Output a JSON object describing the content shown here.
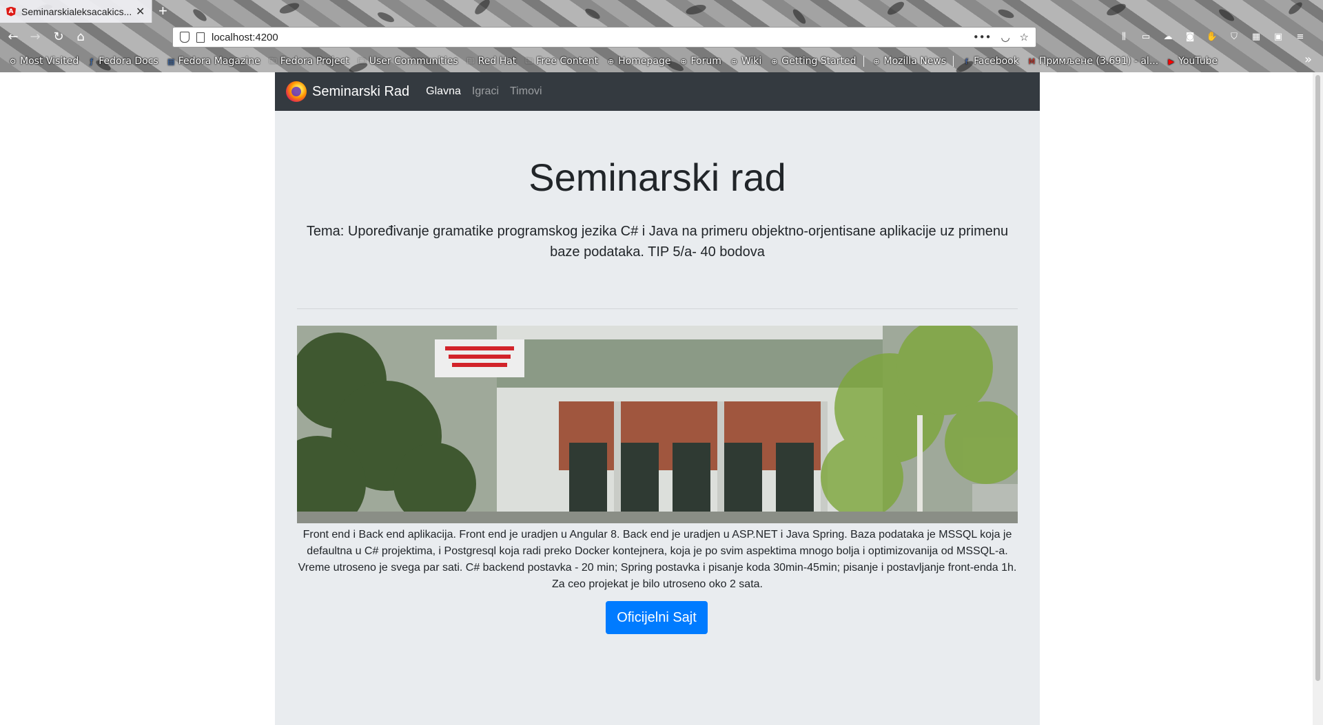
{
  "browser": {
    "tab_title": "Seminarskialeksacakics...",
    "url": "localhost:4200",
    "bookmarks": [
      {
        "label": "Most Visited",
        "icon": "gear-icon"
      },
      {
        "label": "Fedora Docs",
        "icon": "fedora-icon"
      },
      {
        "label": "Fedora Magazine",
        "icon": "magazine-icon"
      },
      {
        "label": "Fedora Project",
        "icon": "folder-icon"
      },
      {
        "label": "User Communities",
        "icon": "folder-icon"
      },
      {
        "label": "Red Hat",
        "icon": "folder-icon"
      },
      {
        "label": "Free Content",
        "icon": "folder-icon"
      },
      {
        "label": "Homepage",
        "icon": "globe-icon"
      },
      {
        "label": "Forum",
        "icon": "globe-icon"
      },
      {
        "label": "Wiki",
        "icon": "globe-icon"
      },
      {
        "label": "Getting Started",
        "icon": "globe-icon"
      },
      {
        "label": "Mozilla News",
        "icon": "globe-icon"
      },
      {
        "label": "Facebook",
        "icon": "facebook-icon"
      },
      {
        "label": "Примљене (3.691) - al...",
        "icon": "gmail-icon"
      },
      {
        "label": "YouTube",
        "icon": "youtube-icon"
      }
    ]
  },
  "app": {
    "brand": "Seminarski Rad",
    "nav": [
      {
        "label": "Glavna",
        "active": true
      },
      {
        "label": "Igraci",
        "active": false
      },
      {
        "label": "Timovi",
        "active": false
      }
    ],
    "title": "Seminarski rad",
    "lead": "Tema: Upoređivanje gramatike programskog jezika C# i Java na primeru objektno-orjentisane aplikacije uz primenu baze podataka. TIP 5/a- 40 bodova",
    "description": "Front end i Back end aplikacija. Front end je uradjen u Angular 8. Back end je uradjen u ASP.NET i Java Spring. Baza podataka je MSSQL koja je defaultna u C# projektima, i Postgresql koja radi preko Docker kontejnera, koja je po svim aspektima mnogo bolja i optimizovanija od MSSQL-a. Vreme utroseno je svega par sati. C# backend postavka - 20 min; Spring postavka i pisanje koda 30min-45min; pisanje i postavljanje front-enda 1h. Za ceo projekat je bilo utroseno oko 2 sata.",
    "button": "Oficijelni Sajt",
    "colors": {
      "navbar": "#343a40",
      "jumbotron": "#e9ecef",
      "button": "#007bff"
    }
  }
}
